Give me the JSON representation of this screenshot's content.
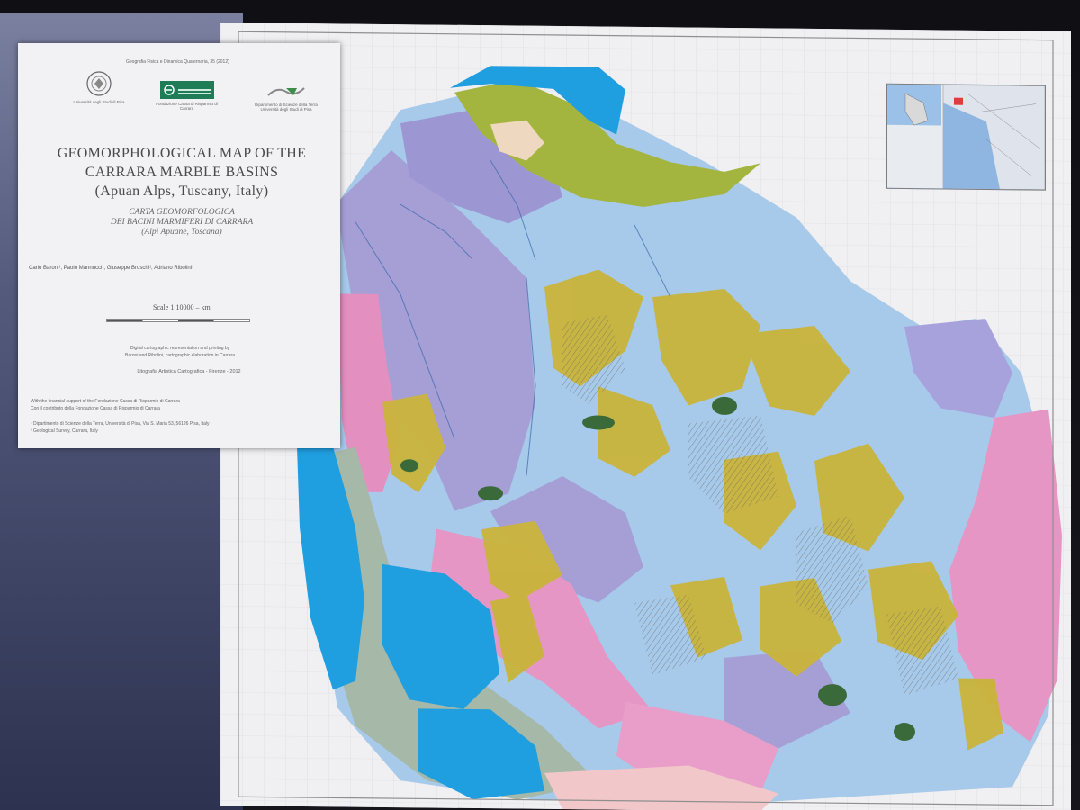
{
  "title_card": {
    "journal_line": "Geografia Fisica e Dinamica Quaternaria, 35 (2012)",
    "logos": [
      {
        "icon": "university-seal-icon",
        "caption": "Università degli Studi di Pisa"
      },
      {
        "icon": "foundation-logo-icon",
        "caption": "Fondazione Cassa di Risparmio di Carrara",
        "color": "#1e7d57"
      },
      {
        "icon": "research-dept-logo-icon",
        "caption": "Dipartimento di Scienze della Terra Università degli Studi di Pisa"
      }
    ],
    "title_en_lines": [
      "GEOMORPHOLOGICAL MAP OF THE",
      "CARRARA MARBLE BASINS",
      "(Apuan Alps, Tuscany, Italy)"
    ],
    "title_it_lines": [
      "CARTA GEOMORFOLOGICA",
      "DEI BACINI MARMIFERI DI CARRARA",
      "(Alpi Apuane, Toscana)"
    ],
    "authors": "Carlo Baroni¹, Paolo Mannucci¹, Giuseppe Bruschi¹, Adriano Ribolini¹",
    "scale_label": "Scale 1:10000 – km",
    "production_note": "Digital cartographic representation and printing by",
    "production_note_2": "Baroni and Ribolini, cartographic elaboration in Carrara",
    "printer": "Litografia Artistica Cartografica - Firenze - 2012",
    "acknowledgement": "With the financial support of the Fondazione Cassa di Risparmio di Carrara",
    "acknowledgement_2": "Con il contributo della Fondazione Cassa di Risparmio di Carrara",
    "affiliation": "¹ Dipartimento di Scienze della Terra, Università di Pisa, Via S. Maria 53, 56126 Pisa, Italy",
    "affiliation_2": "² Geological Survey, Carrara, Italy"
  },
  "map": {
    "colors": {
      "sea": "#1f9ee0",
      "lavender": "#a59fd6",
      "light_blue": "#a7c9ea",
      "pink": "#e596c4",
      "olive": "#a3b53e",
      "yellow": "#c9b43b",
      "dark_green": "#3a6a3a",
      "grey_green": "#a6b8a8",
      "white_paper": "#f0eff2",
      "light_pink": "#f2c7c9"
    }
  }
}
